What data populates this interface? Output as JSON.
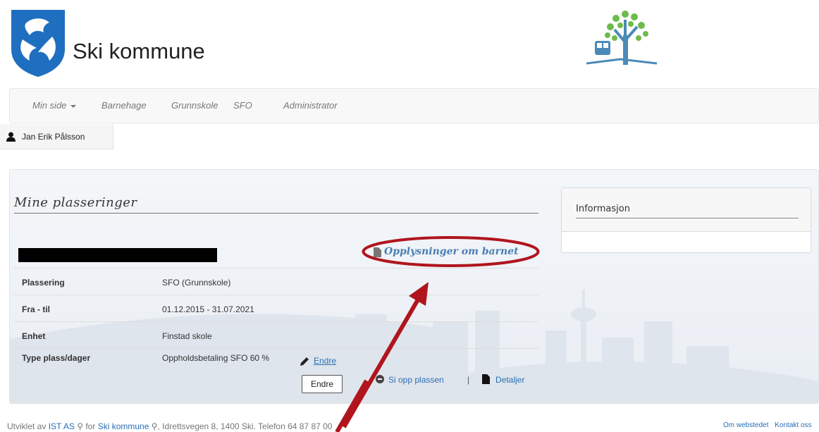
{
  "header": {
    "site_title": "Ski kommune"
  },
  "nav": {
    "items": [
      {
        "label": "Min side",
        "has_caret": true
      },
      {
        "label": "Barnehage"
      },
      {
        "label": "Grunnskole"
      },
      {
        "label": "SFO"
      },
      {
        "label": "Administrator"
      }
    ]
  },
  "user": {
    "name": "Jan Erik Pålsson",
    "icon": "user-icon"
  },
  "main": {
    "section_title": "Mine plasseringer",
    "child_link": "Opplysninger om barnet",
    "rows": [
      {
        "label": "Plassering",
        "value": "SFO  (Grunnskole)"
      },
      {
        "label": "Fra - til",
        "value": "01.12.2015 - 31.07.2021"
      },
      {
        "label": "Enhet",
        "value": "Finstad skole"
      },
      {
        "label": "Type plass/dager",
        "value": "Oppholdsbetaling SFO 60 %"
      }
    ],
    "edit_label": "Endre",
    "tooltip": "Endre",
    "cancel_label": "Si opp plassen",
    "separator": "|",
    "details_label": "Detaljer"
  },
  "info": {
    "title": "Informasjon"
  },
  "footer": {
    "developed_by": "Utviklet av",
    "company": "IST AS",
    "for_text": "for",
    "municipality": "Ski kommune",
    "address": ", Idrettsvegen 8, 1400 Ski. Telefon 64 87 87 00",
    "about": "Om webstedet",
    "contact": "Kontakt oss"
  },
  "colors": {
    "link": "#2a6fb5",
    "annotation_red": "#b0151d",
    "shield_blue": "#1f6fc0"
  }
}
